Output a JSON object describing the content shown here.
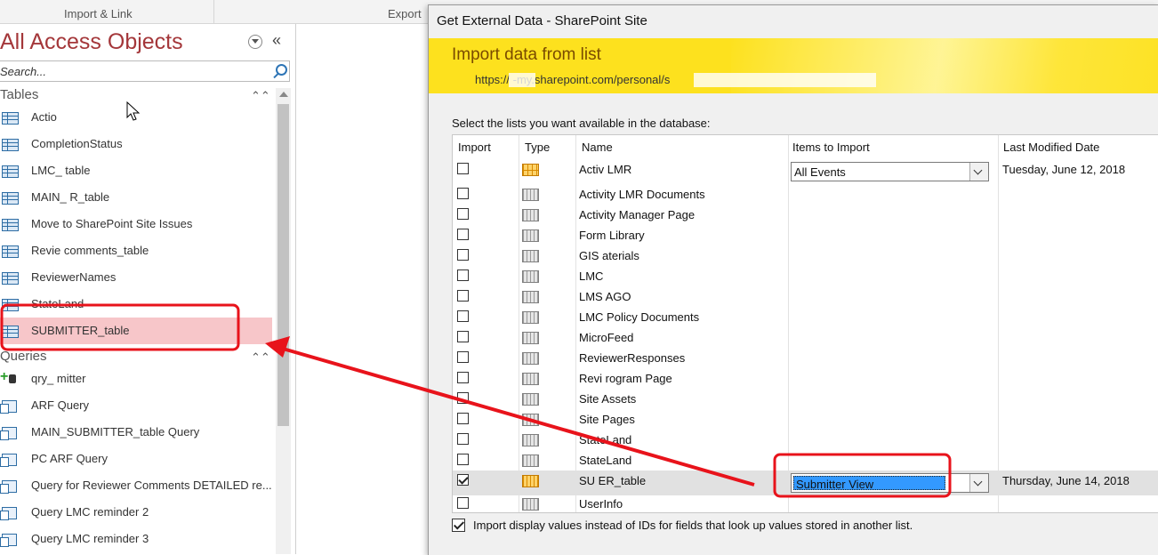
{
  "ribbon": {
    "import_link": "Import & Link",
    "export": "Export"
  },
  "nav": {
    "title": "All Access Objects",
    "search_placeholder": "Search...",
    "groups": {
      "tables": {
        "label": "Tables",
        "items": [
          "Actio",
          "CompletionStatus",
          "LMC_      table",
          "MAIN_           R_table",
          "Move to SharePoint Site Issues",
          "Revie     comments_table",
          "ReviewerNames",
          "StateLand",
          "SUBMITTER_table"
        ],
        "selected_index": 8
      },
      "queries": {
        "label": "Queries",
        "items": [
          "qry_        mitter",
          "ARF Query",
          "MAIN_SUBMITTER_table Query",
          "PC ARF Query",
          "Query for Reviewer Comments DETAILED re...",
          "Query LMC reminder 2",
          "Query LMC reminder 3"
        ]
      }
    }
  },
  "dialog": {
    "title": "Get External Data - SharePoint Site",
    "heading": "Import data from list",
    "url": "https://        -my.sharepoint.com/personal/s",
    "instruction": "Select the lists you want available in the database:",
    "columns": [
      "Import",
      "Type",
      "Name",
      "Items to Import",
      "Last Modified Date"
    ],
    "rows": [
      {
        "name": "Activ   LMR",
        "checked": false,
        "icon": "gold-grid-list-icon",
        "items": "All Events",
        "date": "Tuesday, June 12, 2018"
      },
      {
        "name": "Activity LMR Documents",
        "checked": false,
        "icon": "list-icon"
      },
      {
        "name": "Activity Manager Page",
        "checked": false,
        "icon": "list-icon"
      },
      {
        "name": "Form Library",
        "checked": false,
        "icon": "list-icon"
      },
      {
        "name": "GIS           aterials",
        "checked": false,
        "icon": "list-icon"
      },
      {
        "name": "LMC",
        "checked": false,
        "icon": "list-icon"
      },
      {
        "name": "LMS AGO",
        "checked": false,
        "icon": "list-icon"
      },
      {
        "name": "LMC Policy Documents",
        "checked": false,
        "icon": "list-icon"
      },
      {
        "name": "MicroFeed",
        "checked": false,
        "icon": "list-icon"
      },
      {
        "name": "ReviewerResponses",
        "checked": false,
        "icon": "list-icon"
      },
      {
        "name": "Revi          rogram Page",
        "checked": false,
        "icon": "list-icon"
      },
      {
        "name": "Site Assets",
        "checked": false,
        "icon": "list-icon"
      },
      {
        "name": "Site Pages",
        "checked": false,
        "icon": "list-icon"
      },
      {
        "name": "StateLand",
        "checked": false,
        "icon": "list-icon"
      },
      {
        "name": "StateLand",
        "checked": false,
        "icon": "list-icon"
      },
      {
        "name": "SU           ER_table",
        "checked": true,
        "icon": "gold-list-icon",
        "items": "Submitter View",
        "date": "Thursday, June 14, 2018",
        "selected": true
      },
      {
        "name": "UserInfo",
        "checked": false,
        "icon": "list-icon"
      }
    ],
    "display_values_label": "Import display values instead of IDs for fields that look up values stored in another list.",
    "display_values_checked": true
  },
  "colors": {
    "accent": "#a4373a",
    "banner": "#fde11e",
    "annotation": "#e8131b",
    "selection": "#f7c6c9"
  }
}
